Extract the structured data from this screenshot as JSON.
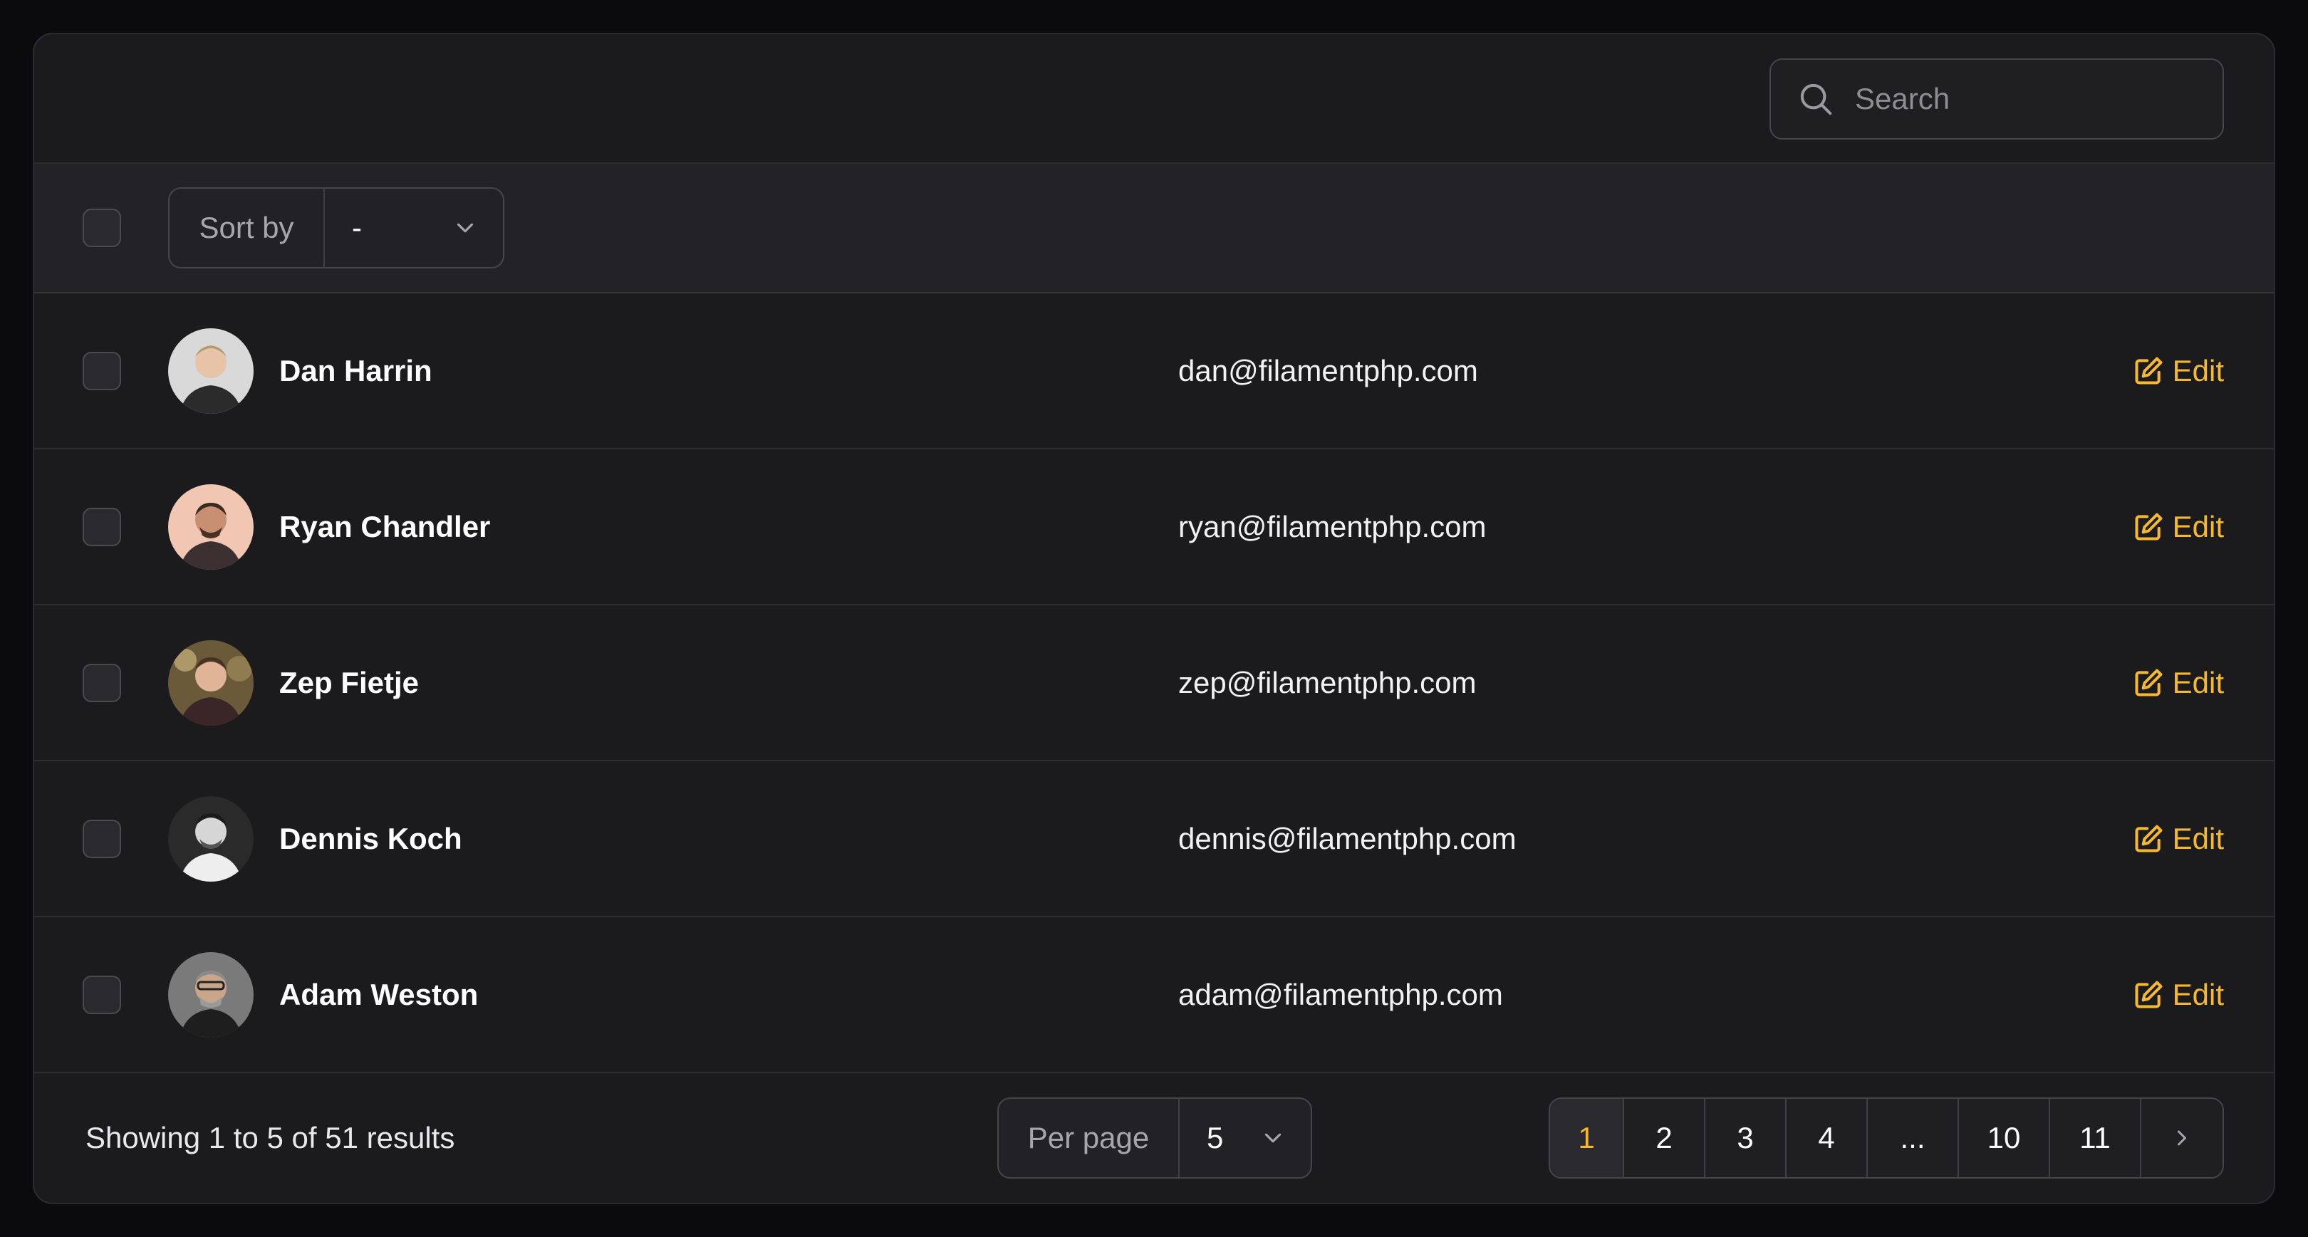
{
  "search": {
    "placeholder": "Search"
  },
  "header": {
    "sort_label": "Sort by",
    "sort_value": "-"
  },
  "rows": [
    {
      "name": "Dan Harrin",
      "email": "dan@filamentphp.com",
      "action": "Edit"
    },
    {
      "name": "Ryan Chandler",
      "email": "ryan@filamentphp.com",
      "action": "Edit"
    },
    {
      "name": "Zep Fietje",
      "email": "zep@filamentphp.com",
      "action": "Edit"
    },
    {
      "name": "Dennis Koch",
      "email": "dennis@filamentphp.com",
      "action": "Edit"
    },
    {
      "name": "Adam Weston",
      "email": "adam@filamentphp.com",
      "action": "Edit"
    }
  ],
  "footer": {
    "showing": "Showing 1 to 5 of 51 results",
    "per_page_label": "Per page",
    "per_page_value": "5",
    "pages": [
      "1",
      "2",
      "3",
      "4",
      "...",
      "10",
      "11"
    ],
    "current_page": "1"
  },
  "colors": {
    "accent": "#f5b82e",
    "background": "#1b1b1e"
  },
  "icons": [
    "search-icon",
    "chevron-down-icon",
    "edit-icon",
    "chevron-right-icon"
  ]
}
